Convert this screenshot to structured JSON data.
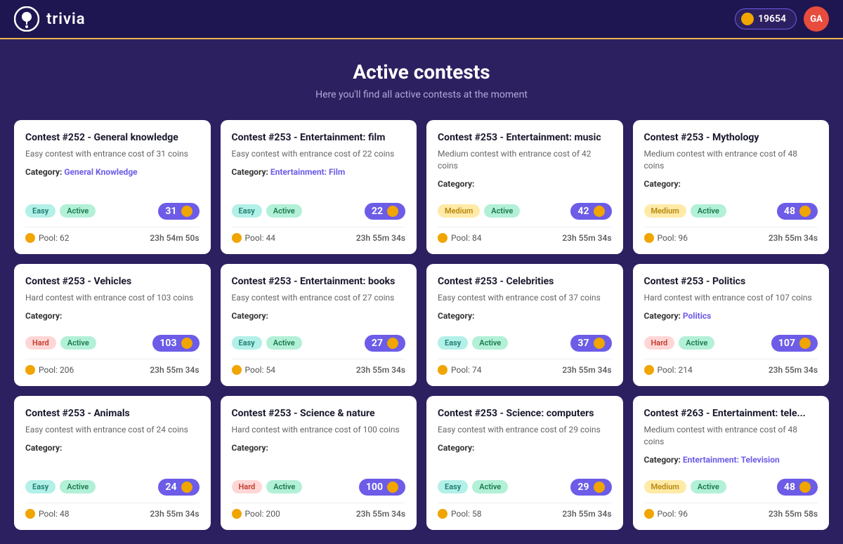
{
  "header": {
    "logo_text": "trivia",
    "coin_balance": "19654",
    "user_initials": "GA"
  },
  "page": {
    "title": "Active contests",
    "subtitle": "Here you'll find all active contests at the moment"
  },
  "contests": [
    {
      "id": 1,
      "title": "Contest #252 - General knowledge",
      "desc": "Easy contest with entrance cost of 31 coins",
      "category_label": "Category:",
      "category_value": "General Knowledge",
      "difficulty": "Easy",
      "difficulty_class": "badge-easy",
      "status": "Active",
      "cost": "31",
      "pool_label": "Pool: 62",
      "timer": "23h 54m 50s"
    },
    {
      "id": 2,
      "title": "Contest #253 - Entertainment: film",
      "desc": "Easy contest with entrance cost of 22 coins",
      "category_label": "Category:",
      "category_value": "Entertainment: Film",
      "difficulty": "Easy",
      "difficulty_class": "badge-easy",
      "status": "Active",
      "cost": "22",
      "pool_label": "Pool: 44",
      "timer": "23h 55m 34s"
    },
    {
      "id": 3,
      "title": "Contest #253 - Entertainment: music",
      "desc": "Medium contest with entrance cost of 42 coins",
      "category_label": "Category:",
      "category_value": "",
      "difficulty": "Medium",
      "difficulty_class": "badge-medium",
      "status": "Active",
      "cost": "42",
      "pool_label": "Pool: 84",
      "timer": "23h 55m 34s"
    },
    {
      "id": 4,
      "title": "Contest #253 - Mythology",
      "desc": "Medium contest with entrance cost of 48 coins",
      "category_label": "Category:",
      "category_value": "",
      "difficulty": "Medium",
      "difficulty_class": "badge-medium",
      "status": "Active",
      "cost": "48",
      "pool_label": "Pool: 96",
      "timer": "23h 55m 34s"
    },
    {
      "id": 5,
      "title": "Contest #253 - Vehicles",
      "desc": "Hard contest with entrance cost of 103 coins",
      "category_label": "Category:",
      "category_value": "",
      "difficulty": "Hard",
      "difficulty_class": "badge-hard",
      "status": "Active",
      "cost": "103",
      "pool_label": "Pool: 206",
      "timer": "23h 55m 34s"
    },
    {
      "id": 6,
      "title": "Contest #253 - Entertainment: books",
      "desc": "Easy contest with entrance cost of 27 coins",
      "category_label": "Category:",
      "category_value": "",
      "difficulty": "Easy",
      "difficulty_class": "badge-easy",
      "status": "Active",
      "cost": "27",
      "pool_label": "Pool: 54",
      "timer": "23h 55m 34s"
    },
    {
      "id": 7,
      "title": "Contest #253 - Celebrities",
      "desc": "Easy contest with entrance cost of 37 coins",
      "category_label": "Category:",
      "category_value": "",
      "difficulty": "Easy",
      "difficulty_class": "badge-easy",
      "status": "Active",
      "cost": "37",
      "pool_label": "Pool: 74",
      "timer": "23h 55m 34s"
    },
    {
      "id": 8,
      "title": "Contest #253 - Politics",
      "desc": "Hard contest with entrance cost of 107 coins",
      "category_label": "Category:",
      "category_value": "Politics",
      "difficulty": "Hard",
      "difficulty_class": "badge-hard",
      "status": "Active",
      "cost": "107",
      "pool_label": "Pool: 214",
      "timer": "23h 55m 34s"
    },
    {
      "id": 9,
      "title": "Contest #253 - Animals",
      "desc": "Easy contest with entrance cost of 24 coins",
      "category_label": "Category:",
      "category_value": "",
      "difficulty": "Easy",
      "difficulty_class": "badge-easy",
      "status": "Active",
      "cost": "24",
      "pool_label": "Pool: 48",
      "timer": "23h 55m 34s"
    },
    {
      "id": 10,
      "title": "Contest #253 - Science & nature",
      "desc": "Hard contest with entrance cost of 100 coins",
      "category_label": "Category:",
      "category_value": "",
      "difficulty": "Hard",
      "difficulty_class": "badge-hard",
      "status": "Active",
      "cost": "100",
      "pool_label": "Pool: 200",
      "timer": "23h 55m 34s"
    },
    {
      "id": 11,
      "title": "Contest #253 - Science: computers",
      "desc": "Easy contest with entrance cost of 29 coins",
      "category_label": "Category:",
      "category_value": "",
      "difficulty": "Easy",
      "difficulty_class": "badge-easy",
      "status": "Active",
      "cost": "29",
      "pool_label": "Pool: 58",
      "timer": "23h 55m 34s"
    },
    {
      "id": 12,
      "title": "Contest #263 - Entertainment: tele...",
      "desc": "Medium contest with entrance cost of 48 coins",
      "category_label": "Category:",
      "category_value": "Entertainment: Television",
      "difficulty": "Medium",
      "difficulty_class": "badge-medium",
      "status": "Active",
      "cost": "48",
      "pool_label": "Pool: 96",
      "timer": "23h 55m 58s"
    }
  ]
}
